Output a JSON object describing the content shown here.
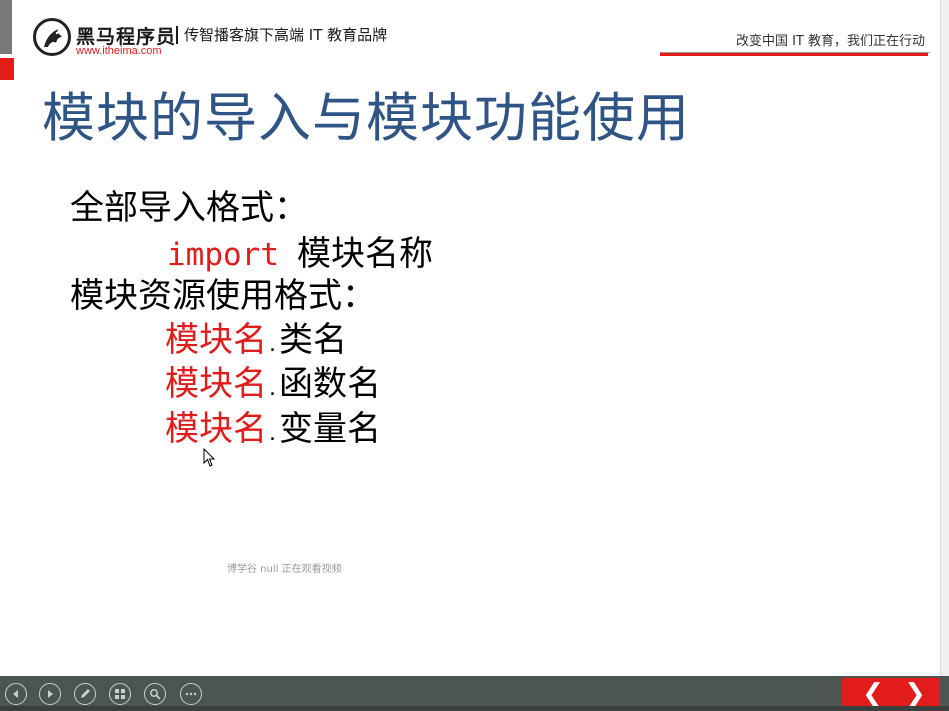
{
  "header": {
    "brand_name": "黑马程序员",
    "brand_url": "www.itheima.com",
    "tagline": "传智播客旗下高端 IT 教育品牌",
    "slogan": "改变中国 IT 教育，我们正在行动"
  },
  "slide": {
    "title": "模块的导入与模块功能使用",
    "lines": {
      "import_format_heading": "全部导入格式：",
      "import_keyword": "import",
      "import_module_name": "模块名称",
      "resource_heading": "模块资源使用格式：",
      "module_name_red": "模块名",
      "dot": ".",
      "class_name": "类名",
      "function_name": "函数名",
      "variable_name": "变量名"
    }
  },
  "watermark": "博学谷 null 正在观看视频",
  "player": {
    "controls": [
      "previous-icon",
      "next-icon",
      "pen-icon",
      "slides-icon",
      "zoom-icon",
      "more-icon"
    ],
    "prev_glyph": "❮",
    "next_glyph": "❯"
  },
  "colors": {
    "title_blue": "#2e5585",
    "accent_red": "#e21b1b",
    "bar_gray": "#4d5552"
  }
}
